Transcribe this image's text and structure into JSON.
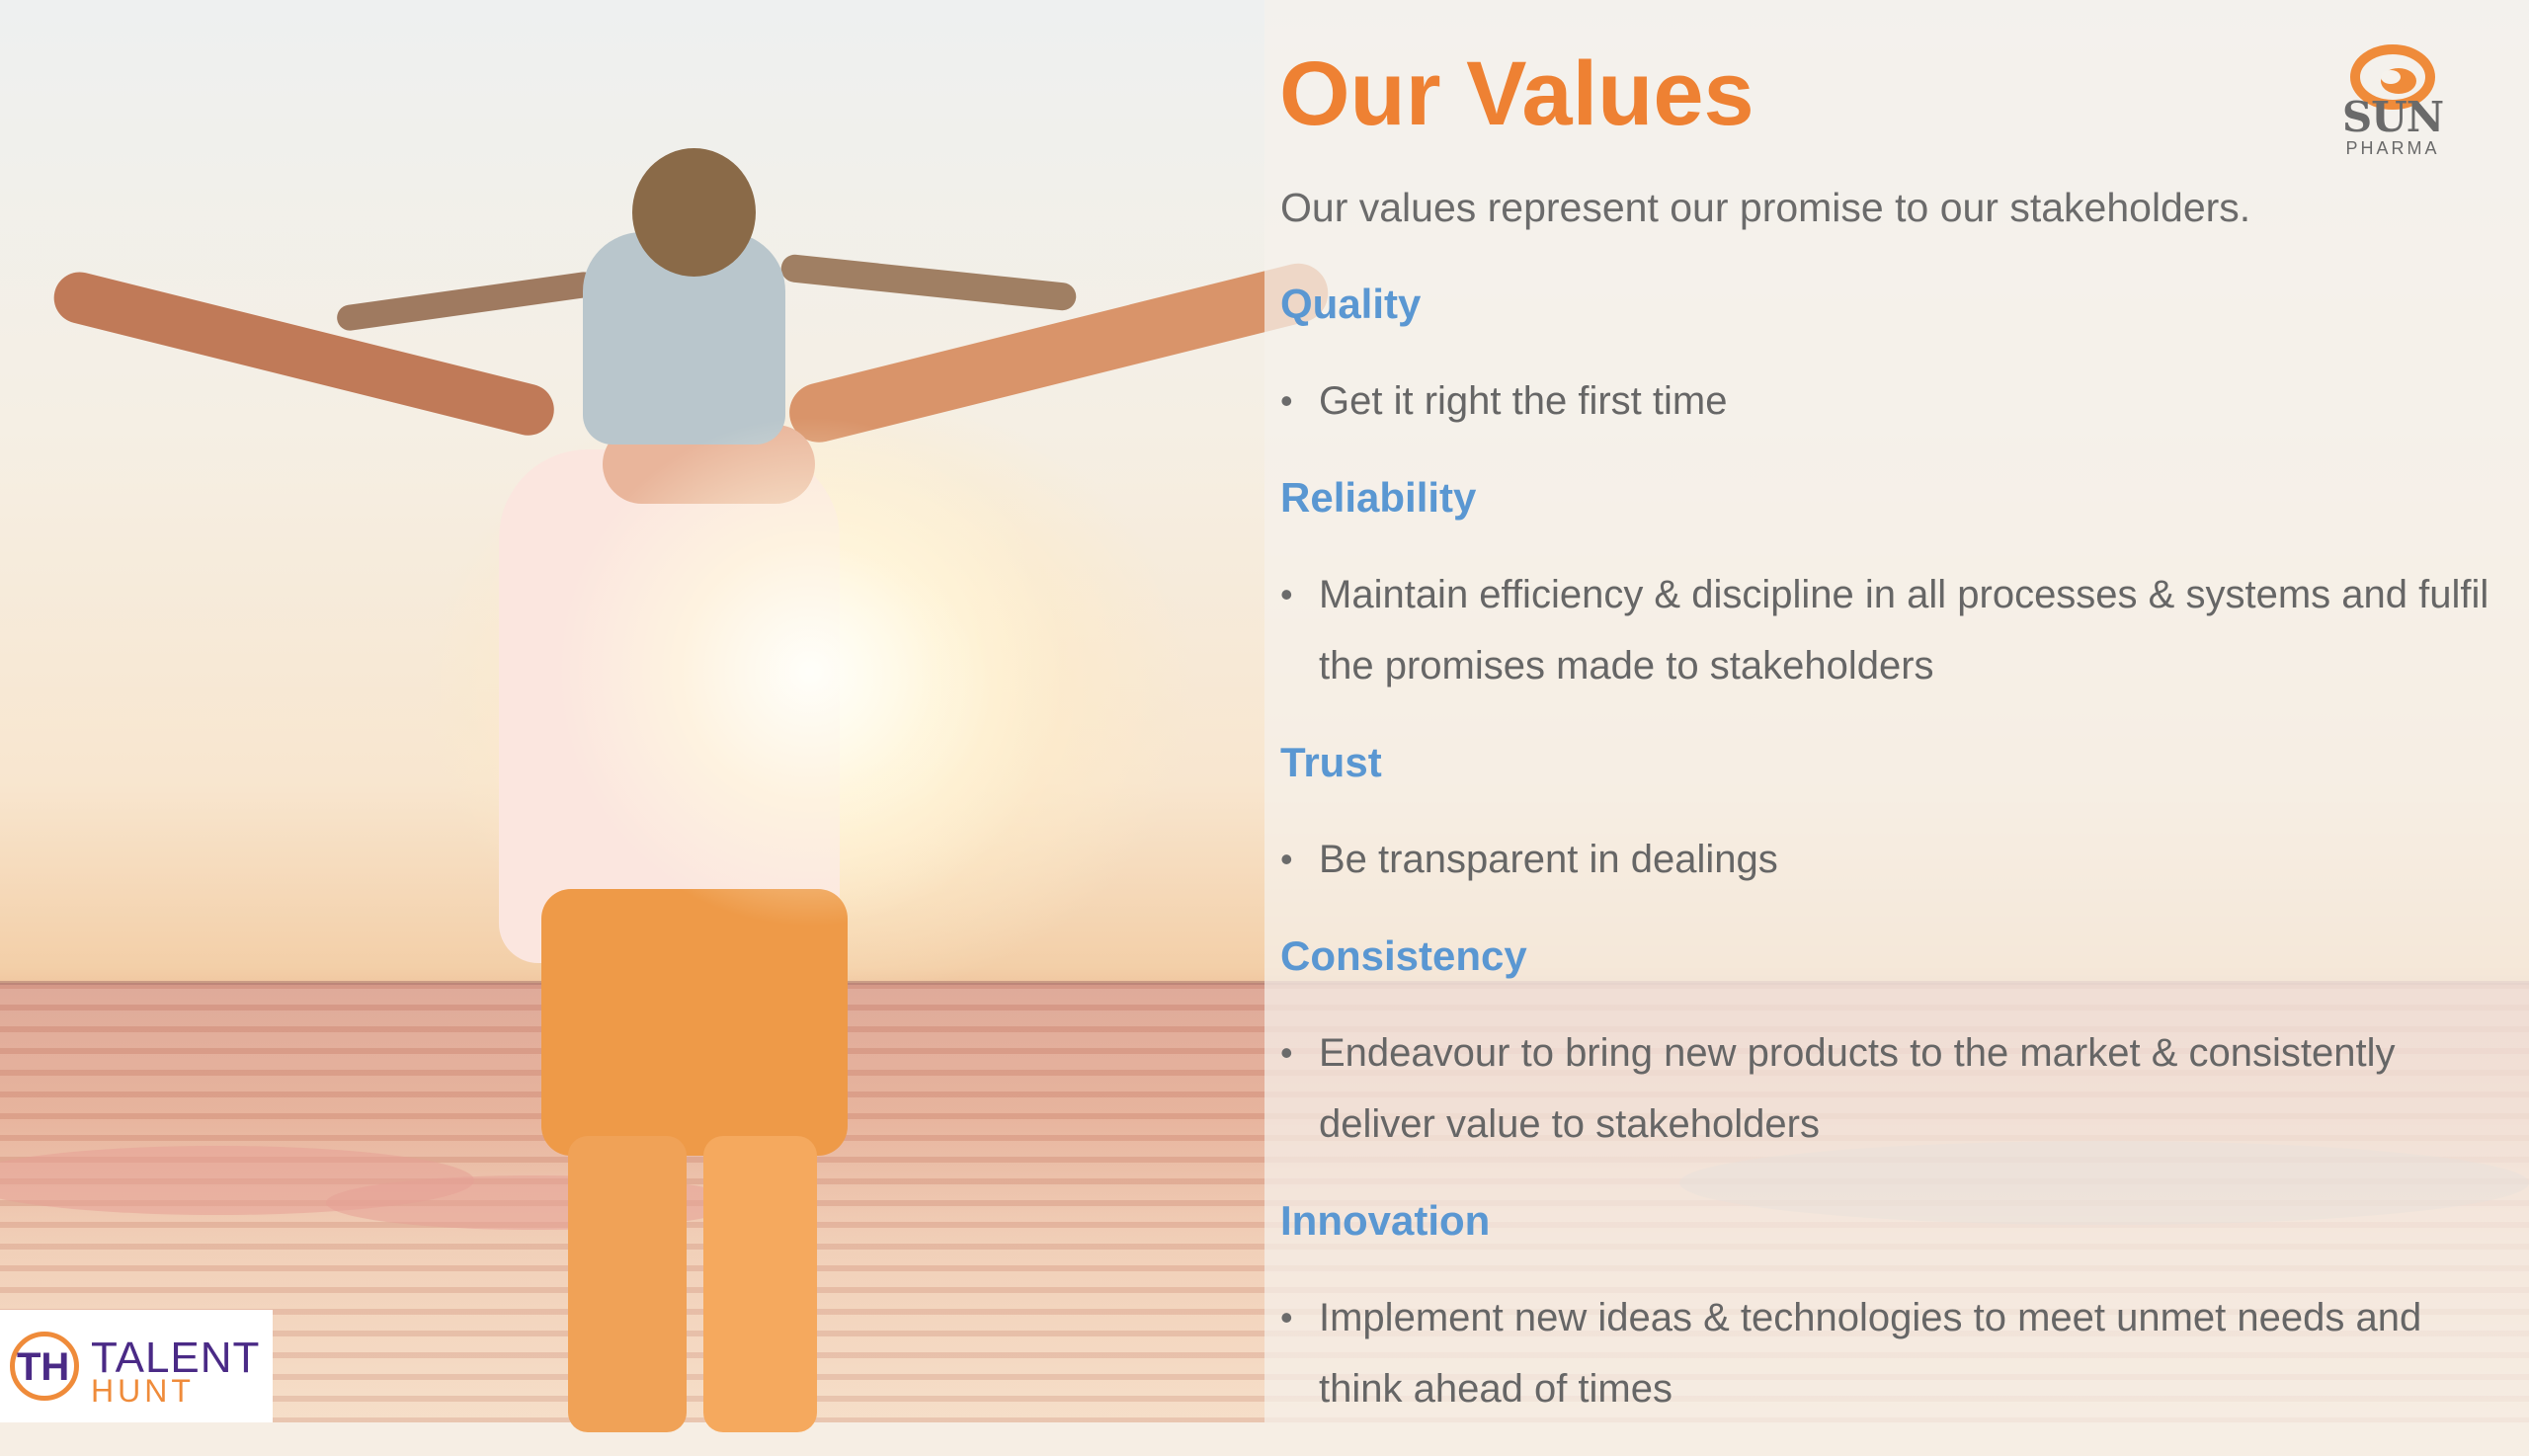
{
  "slide": {
    "title": "Our Values",
    "subtitle": "Our values represent our promise to our stakeholders.",
    "values": [
      {
        "heading": "Quality",
        "bullet": "Get it right the first time"
      },
      {
        "heading": "Reliability",
        "bullet": "Maintain efficiency & discipline in all processes & systems and fulfil the promises made to stakeholders"
      },
      {
        "heading": "Trust",
        "bullet": "Be transparent in dealings"
      },
      {
        "heading": "Consistency",
        "bullet": "Endeavour to bring new products to the market & consistently deliver value to stakeholders"
      },
      {
        "heading": "Innovation",
        "bullet": "Implement new ideas & technologies to meet unmet needs and think ahead of times"
      }
    ]
  },
  "brand_logo": {
    "name": "SUN",
    "tagline": "PHARMA",
    "icon": "sun-pharma-swirl-icon",
    "color": "#ee8133"
  },
  "corner_logo": {
    "mark": "TH",
    "word1": "TALENT",
    "word2": "HUNT",
    "colors": {
      "primary": "#4a2a86",
      "accent": "#ef8b3a"
    }
  },
  "colors": {
    "title": "#ee8133",
    "heading": "#5a97d2",
    "body_text": "#666666"
  },
  "background_image": "father-carrying-child-on-shoulders-at-beach-sunset"
}
